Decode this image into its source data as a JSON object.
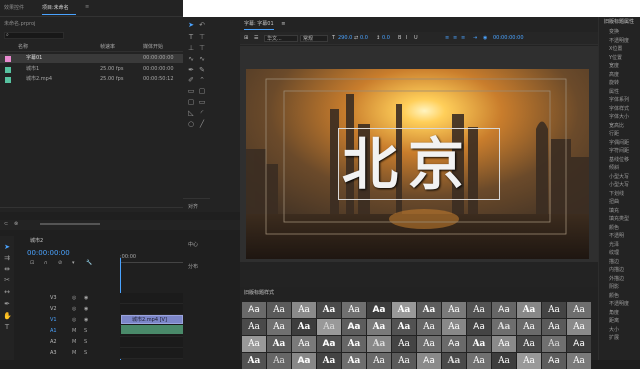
{
  "project": {
    "tabs": [
      "效果控件",
      "项目:未命名"
    ],
    "menu_icon": "≡",
    "file_name": "未命名.prproj",
    "search_placeholder": "",
    "columns": [
      "名称",
      "帧速率",
      "媒体开始"
    ],
    "items": [
      {
        "name": "字幕01",
        "fps": "",
        "start": "00:00:00:00",
        "color": "#e88ad0",
        "selected": true
      },
      {
        "name": "城市1",
        "fps": "25.00 fps",
        "start": "00:00:00:00",
        "color": "#57c2a0",
        "selected": false
      },
      {
        "name": "城市2.mp4",
        "fps": "25.00 fps",
        "start": "00:00:50:12",
        "color": "#57c2a0",
        "selected": false
      }
    ]
  },
  "title_panel": {
    "header": "字幕: 字幕01",
    "menu_icon": "≡",
    "font": "华文...",
    "style": "常规",
    "font_size": "290.0",
    "kerning": "0.0",
    "leading": "0.0",
    "show_video": "00:00:00:00",
    "title_text": "北京"
  },
  "right_panel": {
    "header": "旧版标题属性",
    "items": [
      "变换",
      "不透明度",
      "X位置",
      "Y位置",
      "宽度",
      "高度",
      "旋转",
      "属性",
      "字体系列",
      "字体样式",
      "字体大小",
      "宽高比",
      "行距",
      "字偶间距",
      "字符间距",
      "基线位移",
      "倾斜",
      "小型大写",
      "小型大写",
      "下划线",
      "扭曲",
      "填充",
      "填充类型",
      "颜色",
      "不透明",
      "光泽",
      "纹理",
      "描边",
      "内描边",
      "外描边",
      "阴影",
      "颜色",
      "不透明度",
      "角度",
      "距离",
      "大小",
      "扩展"
    ]
  },
  "timeline": {
    "sequence_name": "城市2",
    "timecode": "00:00:00:00",
    "ruler_start": ":00:00",
    "tracks": [
      "V3",
      "V2",
      "V1",
      "A1",
      "A2",
      "A3"
    ],
    "clip_label": "城市2.mp4 [V]"
  },
  "align_panel": {
    "labels": [
      "对齐",
      "中心",
      "分布"
    ]
  },
  "styles_panel": {
    "header": "旧版标题样式",
    "sample": "Aa"
  },
  "colors": {
    "accent": "#4aa3ff",
    "panel": "#232323",
    "selection": "#3a3a3a"
  }
}
